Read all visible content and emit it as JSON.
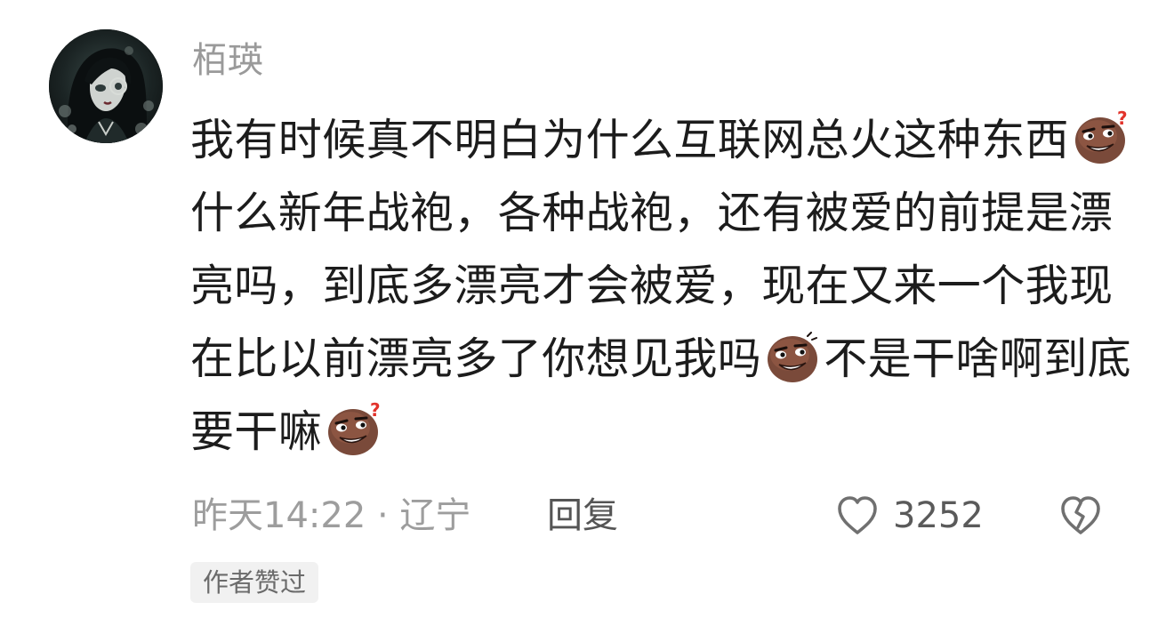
{
  "comment": {
    "username": "栢瑛",
    "segments": [
      {
        "type": "text",
        "value": "我有时候真不明白为什么互联网总火这种东西"
      },
      {
        "type": "emoji",
        "name": "smirk-question-emoji"
      },
      {
        "type": "text",
        "value": "什么新年战袍，各种战袍，还有被爱的前提是漂亮吗，到底多漂亮才会被爱，现在又来一个我现在比以前漂亮多了你想见我吗"
      },
      {
        "type": "emoji",
        "name": "smirk-emoji"
      },
      {
        "type": "text",
        "value": "不是干啥啊到底要干嘛"
      },
      {
        "type": "emoji",
        "name": "smirk-question-emoji"
      }
    ],
    "time_location": "昨天14:22 · 辽宁",
    "reply_label": "回复",
    "like_count": "3252",
    "badge": "作者赞过"
  },
  "icons": {
    "like": "heart-outline-icon",
    "dislike": "broken-heart-icon"
  },
  "colors": {
    "username": "#9a9a9a",
    "text": "#1c1c1c",
    "meta": "#9d9d9d",
    "badge_bg": "#f1f1f1"
  }
}
